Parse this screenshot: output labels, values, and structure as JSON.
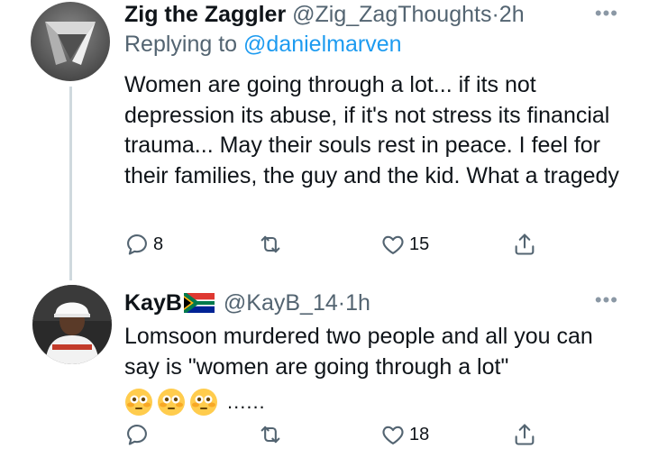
{
  "tweets": [
    {
      "name": "Zig the Zaggler",
      "handle": "@Zig_ZagThoughts",
      "separator": "·",
      "time": "2h",
      "replying_prefix": "Replying to",
      "replying_to": "@danielmarven",
      "text": "Women are going through a lot... if its not depression its abuse, if it's not stress its financial trauma... May their souls rest in peace. I feel for their families, the guy and the kid. What a tragedy",
      "replies": "8",
      "retweets": "",
      "likes": "15",
      "more": "•••"
    },
    {
      "name": "KayB",
      "handle": "@KayB_14",
      "separator": "·",
      "time": "1h",
      "text": "Lomsoon murdered two people and all you can say is \"women are going through a lot\"",
      "emoji_trail": "......",
      "replies": "",
      "retweets": "",
      "likes": "18",
      "more": "•••"
    }
  ],
  "icons": {
    "reply": "reply-icon",
    "retweet": "retweet-icon",
    "like": "heart-icon",
    "share": "share-icon",
    "flag": "south-africa-flag-icon",
    "emoji": "flushed-face-emoji"
  },
  "colors": {
    "text": "#0f1419",
    "muted": "#536471",
    "link": "#1d9bf0",
    "thread": "#cfd9de"
  }
}
